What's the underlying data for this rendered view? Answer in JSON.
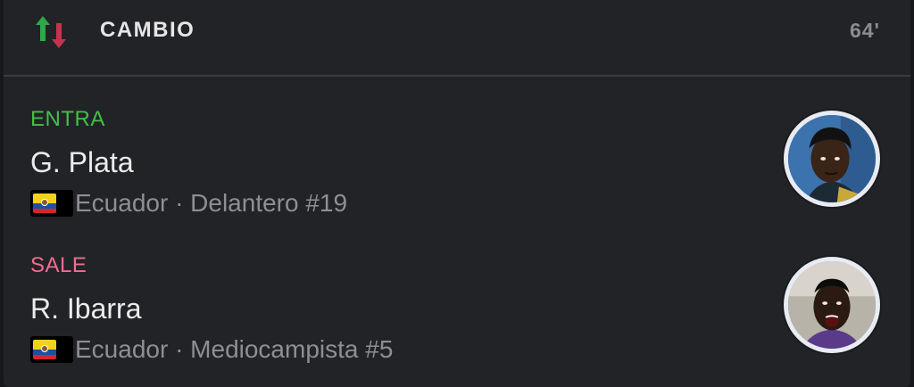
{
  "header": {
    "title": "CAMBIO",
    "minute": "64'",
    "icon": "substitution-arrows-icon"
  },
  "player_in": {
    "role": "ENTRA",
    "name": "G. Plata",
    "meta": "Ecuador · Delantero #19",
    "flag": "ecuador-flag-icon",
    "role_color": "#43c047"
  },
  "player_out": {
    "role": "SALE",
    "name": "R. Ibarra",
    "meta": "Ecuador · Mediocampista #5",
    "flag": "ecuador-flag-icon",
    "role_color": "#f26c8d"
  }
}
